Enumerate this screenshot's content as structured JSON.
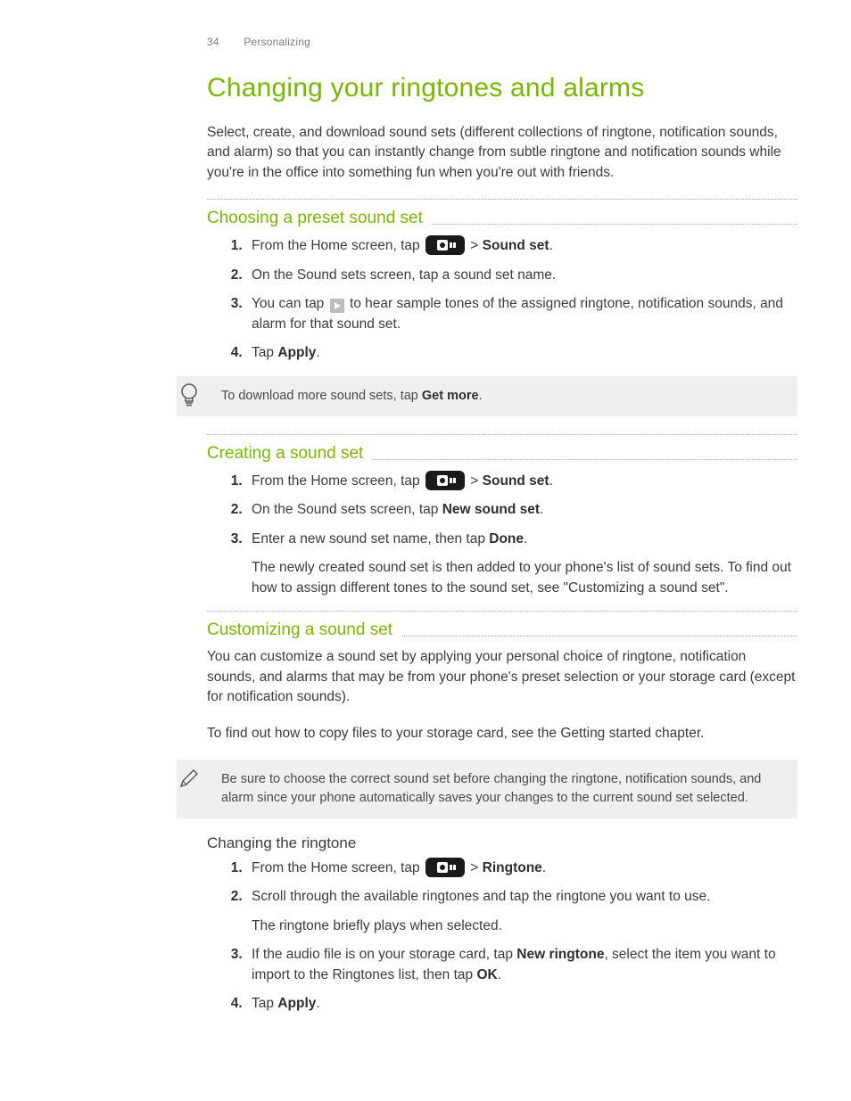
{
  "header": {
    "page_number": "34",
    "section": "Personalizing"
  },
  "title": "Changing your ringtones and alarms",
  "intro": "Select, create, and download sound sets (different collections of ringtone, notification sounds, and alarm) so that you can instantly change from subtle ringtone and notification sounds while you're in the office into something fun when you're out with friends.",
  "sections": {
    "choosing": {
      "heading": "Choosing a preset sound set",
      "steps": {
        "s1a": "From the Home screen, tap ",
        "s1b": " > ",
        "s1c": "Sound set",
        "s1d": ".",
        "s2": "On the Sound sets screen, tap a sound set name.",
        "s3a": "You can tap ",
        "s3b": " to hear sample tones of the assigned ringtone, notification sounds, and alarm for that sound set.",
        "s4a": "Tap ",
        "s4b": "Apply",
        "s4c": "."
      },
      "tip_a": "To download more sound sets, tap ",
      "tip_b": "Get more",
      "tip_c": "."
    },
    "creating": {
      "heading": "Creating a sound set",
      "steps": {
        "s1a": "From the Home screen, tap ",
        "s1b": " > ",
        "s1c": "Sound set",
        "s1d": ".",
        "s2a": "On the Sound sets screen, tap ",
        "s2b": "New sound set",
        "s2c": ".",
        "s3a": "Enter a new sound set name, then tap ",
        "s3b": "Done",
        "s3c": ".",
        "s3_after": "The newly created sound set is then added to your phone's list of sound sets. To find out how to assign different tones to the sound set, see \"Customizing a sound set\"."
      }
    },
    "customizing": {
      "heading": "Customizing a sound set",
      "p1": "You can customize a sound set by applying your personal choice of ringtone, notification sounds, and alarms that may be from your phone's preset selection or your storage card (except for notification sounds).",
      "p2": "To find out how to copy files to your storage card, see the Getting started chapter.",
      "note": "Be sure to choose the correct sound set before changing the ringtone, notification sounds, and alarm since your phone automatically saves your changes to the current sound set selected.",
      "sub_heading": "Changing the ringtone",
      "steps": {
        "s1a": "From the Home screen, tap ",
        "s1b": " > ",
        "s1c": "Ringtone",
        "s1d": ".",
        "s2": "Scroll through the available ringtones and tap the ringtone you want to use.",
        "s2_after": "The ringtone briefly plays when selected.",
        "s3a": "If the audio file is on your storage card, tap ",
        "s3b": "New ringtone",
        "s3c": ", select the item you want to import to the Ringtones list, then tap ",
        "s3d": "OK",
        "s3e": ".",
        "s4a": "Tap ",
        "s4b": "Apply",
        "s4c": "."
      }
    }
  }
}
